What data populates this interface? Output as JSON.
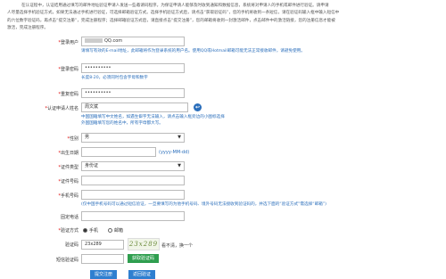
{
  "intro": {
    "line1": "在认证程中，认证结用通过填写的邮件地址验证申请人发送一些邀请码程序。为保证申请人能够及时收到通知和数据信息，系统将对申请人的手机或邮件进行验证。请申请",
    "line2": "人尽量选择手机验证方式，如果无法通过手机进行验证，可选择邮箱验证方式。选择手机验证方式后，请点击“获取验证码”，您的手机将收到一条短信，请在验证码输入框中输入短信中",
    "line3": "的六位数字验证码，再点击“提交注册”，完成注册程序；选择邮箱验证方式后，请直接点击“提交注册”，您的邮箱将收到一封激活邮件，点击邮件中的激活链接，您的注册信息才能被",
    "line4": "激活，完成注册程序。"
  },
  "fields": {
    "user": {
      "label": "登录用户",
      "value": "QQ.com",
      "hint": "请填写有效的E-mail地址，此邮箱将作为登录系统的用户名。使用QQ或Hotmail邮箱可能无法正常接收邮件，请避免使用。"
    },
    "password": {
      "label": "登录密码",
      "value": "••••••••••",
      "hint": "长度8-20，必须同时包含字母和数字"
    },
    "confirm": {
      "label": "重复密码",
      "value": "••••••••••"
    },
    "name": {
      "label": "认证申请人姓名",
      "value": "周文斌",
      "hint1": "中国国籍填写中文姓名，如遇生僻字无法输入，请点击输入框旁边的小图标选择",
      "hint2": "外国国籍填写您的姓名中，所有字母都大写。"
    },
    "gender": {
      "label": "性别",
      "value": "男"
    },
    "birth": {
      "label": "出生日期",
      "value": "",
      "format": "(yyyy-MM-dd)"
    },
    "idtype": {
      "label": "证件类型",
      "value": "身份证"
    },
    "idno": {
      "label": "证件号码",
      "value": ""
    },
    "mobile": {
      "label": "手机号码",
      "value": "",
      "hint": "(仅中国手机号码可以通过短信验证，一旦要填写的为他手机号码、境外号码无法接收到验证码的，并选下面的“验证方式”需选择“邮箱”)"
    },
    "phone": {
      "label": "固定电话",
      "value": ""
    },
    "verify": {
      "label": "验证方式",
      "opt1": "手机",
      "opt2": "邮箱"
    },
    "captcha": {
      "label": "验证码",
      "value": "23x289",
      "image_text": "23x289",
      "refresh": "看不清，换一个"
    },
    "sms": {
      "label": "短信验证码",
      "value": "",
      "button": "获取验证码"
    }
  },
  "buttons": {
    "submit": "提交注册",
    "back": "返回验证"
  },
  "colors": {
    "primary": "#2f7fd0",
    "success": "#2f9e4f",
    "hint": "#2a6ebb",
    "required": "#dd0000"
  }
}
